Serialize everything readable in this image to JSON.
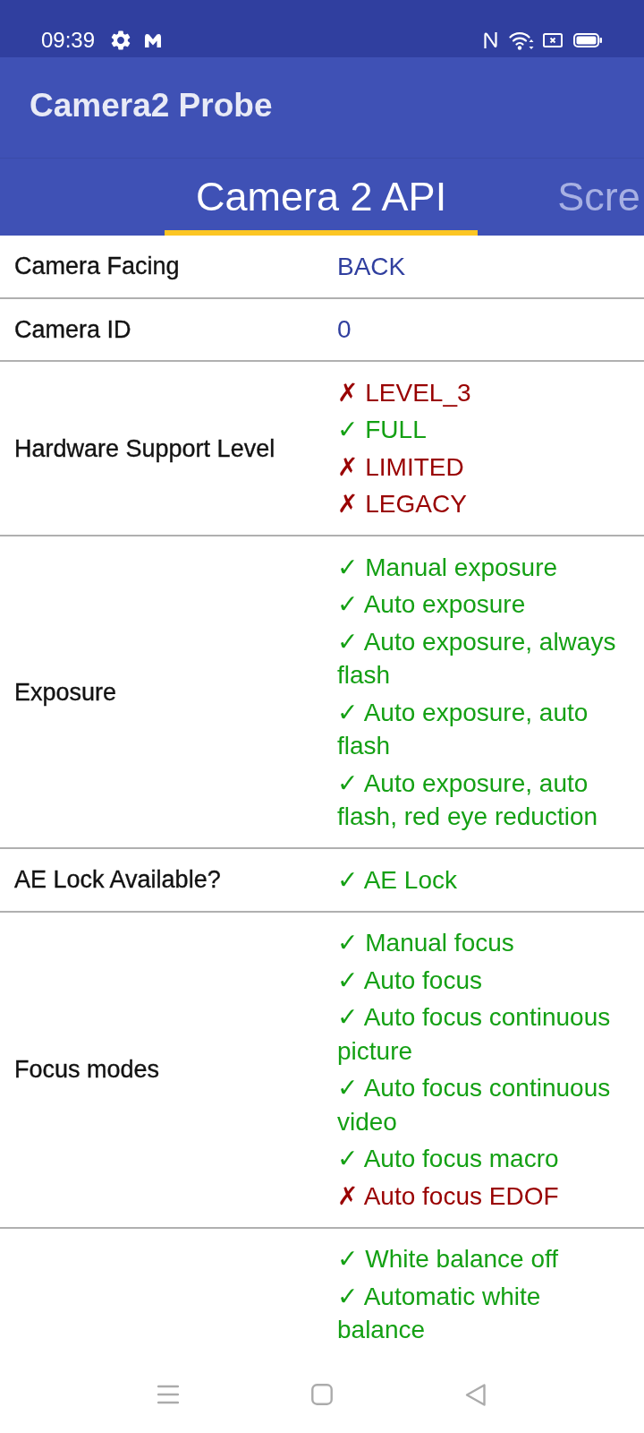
{
  "status_bar": {
    "time": "09:39"
  },
  "app_bar": {
    "title": "Camera2 Probe"
  },
  "tabs": [
    {
      "label": "Camera 2 API",
      "selected": true
    },
    {
      "label": "Scre",
      "selected": false
    }
  ],
  "rows": [
    {
      "label": "Camera Facing",
      "values": [
        {
          "kind": "plain",
          "text": "BACK"
        }
      ]
    },
    {
      "label": "Camera ID",
      "values": [
        {
          "kind": "plain",
          "text": "0"
        }
      ]
    },
    {
      "label": "Hardware Support Level",
      "values": [
        {
          "kind": "feature",
          "text": "✗ LEVEL_3",
          "supported": false
        },
        {
          "kind": "feature",
          "text": "✓ FULL",
          "supported": true
        },
        {
          "kind": "feature",
          "text": "✗ LIMITED",
          "supported": false
        },
        {
          "kind": "feature",
          "text": "✗ LEGACY",
          "supported": false
        }
      ]
    },
    {
      "label": "Exposure",
      "values": [
        {
          "kind": "feature",
          "text": "✓ Manual exposure",
          "supported": true
        },
        {
          "kind": "feature",
          "text": "✓ Auto exposure",
          "supported": true
        },
        {
          "kind": "feature",
          "text": "✓ Auto exposure, always flash",
          "supported": true
        },
        {
          "kind": "feature",
          "text": "✓ Auto exposure, auto flash",
          "supported": true
        },
        {
          "kind": "feature",
          "text": "✓ Auto exposure, auto flash, red eye reduction",
          "supported": true
        }
      ]
    },
    {
      "label": "AE Lock Available?",
      "values": [
        {
          "kind": "feature",
          "text": "✓ AE Lock",
          "supported": true
        }
      ]
    },
    {
      "label": "Focus modes",
      "values": [
        {
          "kind": "feature",
          "text": "✓ Manual focus",
          "supported": true
        },
        {
          "kind": "feature",
          "text": "✓ Auto focus",
          "supported": true
        },
        {
          "kind": "feature",
          "text": "✓ Auto focus continuous picture",
          "supported": true
        },
        {
          "kind": "feature",
          "text": "✓ Auto focus continuous video",
          "supported": true
        },
        {
          "kind": "feature",
          "text": "✓ Auto focus macro",
          "supported": true
        },
        {
          "kind": "feature",
          "text": "✗ Auto focus EDOF",
          "supported": false
        }
      ]
    },
    {
      "values": [
        {
          "kind": "feature",
          "text": "✓ White balance off",
          "supported": true
        },
        {
          "kind": "feature",
          "text": "✓ Automatic white balance",
          "supported": true
        }
      ]
    }
  ]
}
